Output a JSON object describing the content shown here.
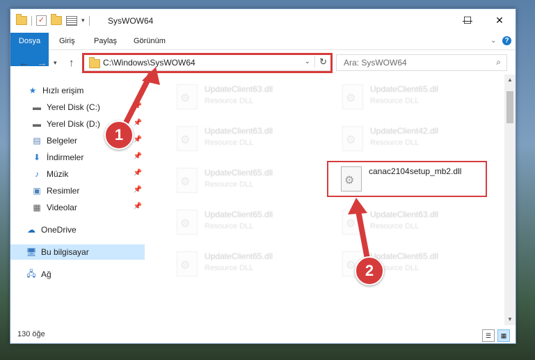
{
  "window": {
    "title": "SysWOW64",
    "controls": {
      "minimize": "—",
      "maximize": "☐",
      "close": "✕"
    }
  },
  "ribbon": {
    "tabs": [
      "Dosya",
      "Giriş",
      "Paylaş",
      "Görünüm"
    ],
    "expand_icon": "chevron-down-icon",
    "help_label": "?"
  },
  "address_bar": {
    "path": "C:\\Windows\\SysWOW64"
  },
  "search": {
    "placeholder": "Ara: SysWOW64"
  },
  "nav_pane": {
    "items": [
      {
        "label": "Hızlı erişim",
        "icon": "star-icon"
      },
      {
        "label": "Yerel Disk (C:)",
        "icon": "drive-icon",
        "pinned": true
      },
      {
        "label": "Yerel Disk (D:)",
        "icon": "drive-icon",
        "pinned": true
      },
      {
        "label": "Belgeler",
        "icon": "documents-icon",
        "pinned": true
      },
      {
        "label": "İndirmeler",
        "icon": "download-icon",
        "pinned": true
      },
      {
        "label": "Müzik",
        "icon": "music-icon",
        "pinned": true
      },
      {
        "label": "Resimler",
        "icon": "pictures-icon",
        "pinned": true
      },
      {
        "label": "Videolar",
        "icon": "videos-icon",
        "pinned": true
      },
      {
        "label": "OneDrive",
        "icon": "cloud-icon"
      },
      {
        "label": "Bu bilgisayar",
        "icon": "computer-icon",
        "selected": true
      },
      {
        "label": "Ağ",
        "icon": "network-icon"
      }
    ]
  },
  "files": [
    {
      "name": "UpdateClient63.dll",
      "type": "Resource DLL"
    },
    {
      "name": "UpdateClient65.dll",
      "type": "Resource DLL"
    },
    {
      "name": "UpdateClient63.dll",
      "type": "Resource DLL"
    },
    {
      "name": "UpdateClient42.dll",
      "type": "Resource DLL"
    },
    {
      "name": "UpdateClient65.dll",
      "type": "Resource DLL"
    },
    {
      "name": "canac2104setup_mb2.dll",
      "type": "",
      "highlighted": true
    },
    {
      "name": "UpdateClient65.dll",
      "type": "Resource DLL"
    },
    {
      "name": "UpdateClient63.dll",
      "type": "Resource DLL"
    },
    {
      "name": "UpdateClient65.dll",
      "type": "Resource DLL"
    },
    {
      "name": "UpdateClient65.dll",
      "type": "Resource DLL"
    }
  ],
  "status": {
    "item_count": "130 öğe"
  },
  "annotations": {
    "step1": "1",
    "step2": "2",
    "color": "#d63b3b"
  }
}
